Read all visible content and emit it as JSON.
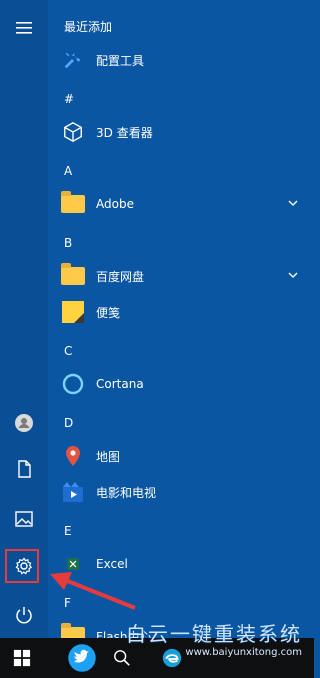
{
  "start_menu": {
    "sections": {
      "recent": "最近添加",
      "hash": "#",
      "a": "A",
      "b": "B",
      "c": "C",
      "d": "D",
      "e": "E",
      "f": "F"
    },
    "items": {
      "config_tool": "配置工具",
      "viewer_3d": "3D 查看器",
      "adobe": "Adobe",
      "baidu": "百度网盘",
      "sticky": "便笺",
      "cortana": "Cortana",
      "maps": "地图",
      "movies": "电影和电视",
      "excel": "Excel",
      "flash": "Flash中心"
    }
  },
  "rail": {
    "icons": [
      "hamburger-icon",
      "user-icon",
      "document-icon",
      "pictures-icon",
      "settings-icon",
      "power-icon"
    ]
  },
  "taskbar": {
    "icons": [
      "windows-start-icon",
      "twitter-icon",
      "search-icon",
      "edge-icon"
    ]
  },
  "watermark": {
    "text": "白云一键重装系统",
    "url": "www.baiyunxitong.com"
  },
  "colors": {
    "background": "#0b56a2",
    "rail": "#0a4f95",
    "highlight": "#e53b3b",
    "folder": "#ffc94a"
  }
}
